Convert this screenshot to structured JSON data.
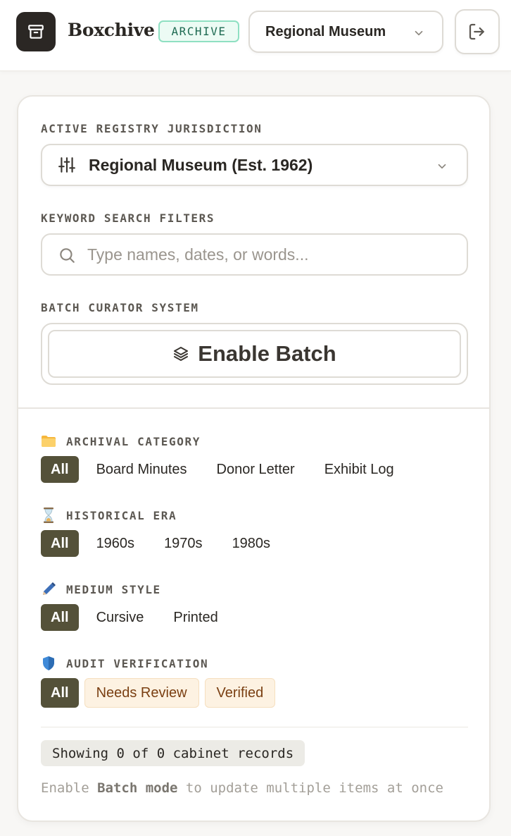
{
  "header": {
    "brand": "Boxchive",
    "badge": "ARCHIVE",
    "museum_select": "Regional Museum",
    "icons": {
      "logo": "archive-box-icon",
      "select": "chevron-down-icon",
      "logout": "logout-icon"
    }
  },
  "filters_panel": {
    "jurisdiction": {
      "label": "ACTIVE REGISTRY JURISDICTION",
      "value": "Regional Museum (Est. 1962)",
      "icon": "sliders-icon"
    },
    "search": {
      "label": "KEYWORD SEARCH FILTERS",
      "placeholder": "Type names, dates, or words...",
      "value": "",
      "icon": "search-icon"
    },
    "batch": {
      "label": "BATCH CURATOR SYSTEM",
      "button": "Enable Batch",
      "icon": "layers-icon"
    },
    "groups": [
      {
        "icon": "folder-icon",
        "label": "ARCHIVAL CATEGORY",
        "options": [
          "All",
          "Board Minutes",
          "Donor Letter",
          "Exhibit Log"
        ],
        "selected": "All"
      },
      {
        "icon": "hourglass-icon",
        "label": "HISTORICAL ERA",
        "options": [
          "All",
          "1960s",
          "1970s",
          "1980s"
        ],
        "selected": "All"
      },
      {
        "icon": "pen-icon",
        "label": "MEDIUM STYLE",
        "options": [
          "All",
          "Cursive",
          "Printed"
        ],
        "selected": "All"
      },
      {
        "icon": "shield-icon",
        "label": "AUDIT VERIFICATION",
        "options": [
          "All",
          "Needs Review",
          "Verified"
        ],
        "selected": "All"
      }
    ],
    "status": "Showing 0 of 0 cabinet records",
    "hint": {
      "pre": "Enable ",
      "strong": "Batch mode",
      "post": " to update multiple items at once"
    }
  },
  "colors": {
    "accent": "#545139",
    "badge_green": "#1f6b53",
    "warn_bg": "#fdf2e2",
    "warn_text": "#7a3f12"
  }
}
